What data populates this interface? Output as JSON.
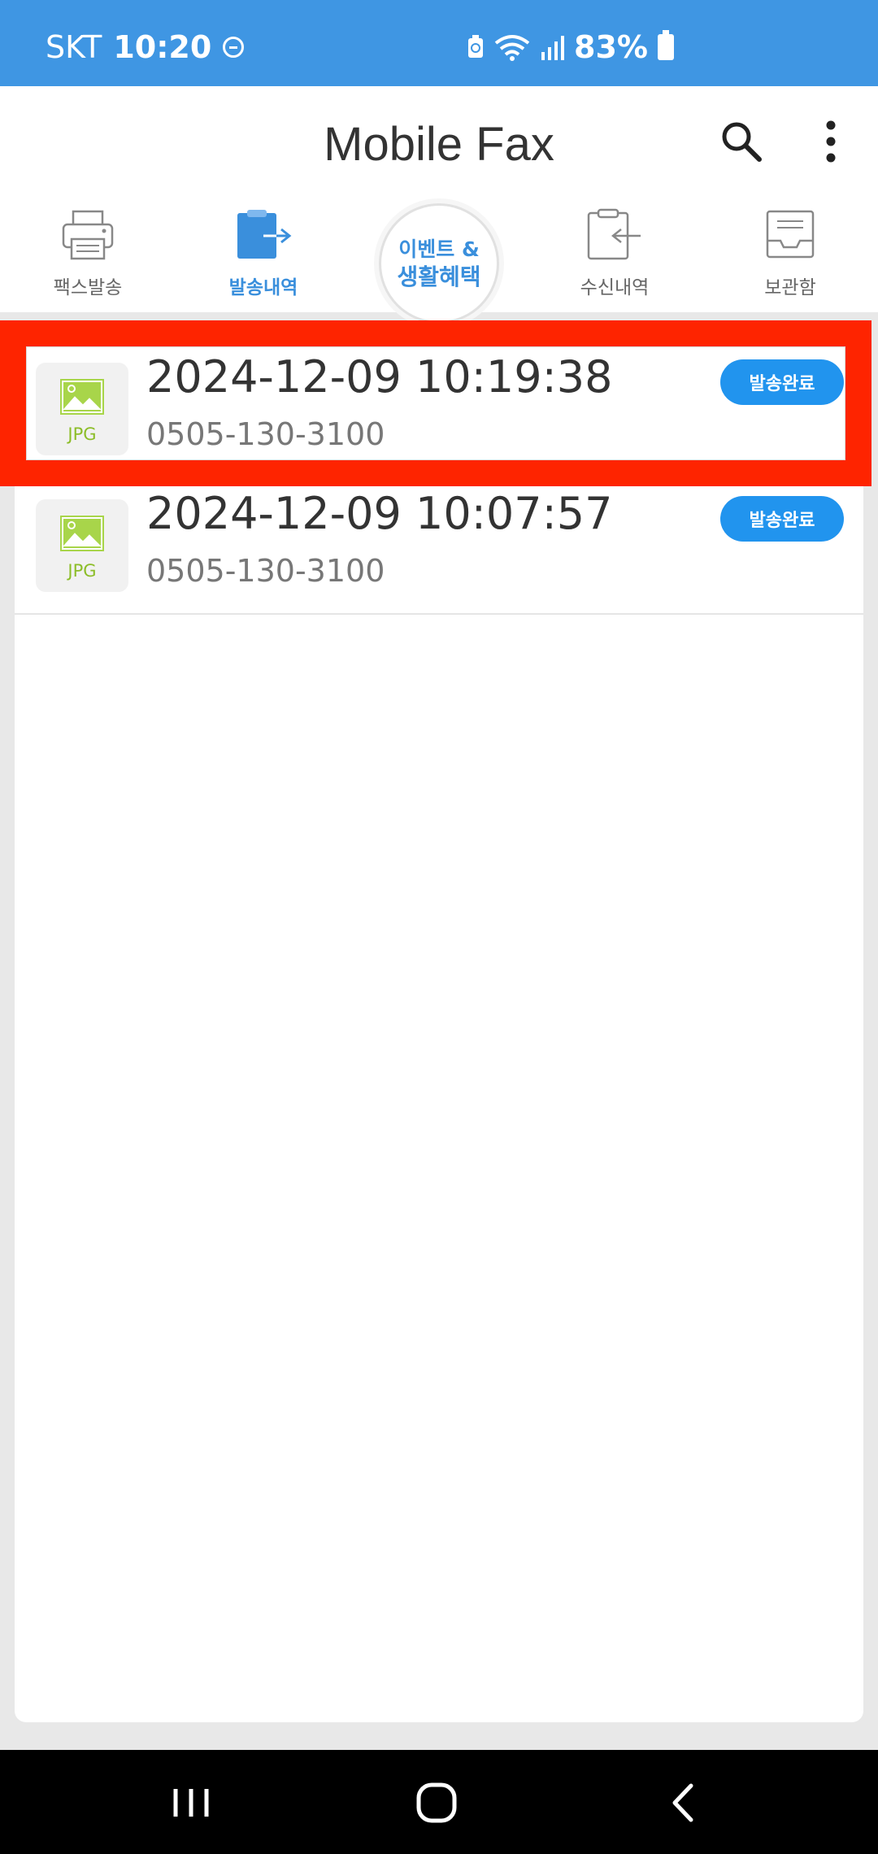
{
  "status_bar": {
    "carrier": "SKT",
    "time": "10:20",
    "battery": "83%",
    "icons": [
      "dnd-icon",
      "battery-saver-icon",
      "wifi-icon",
      "signal-icon",
      "battery-icon"
    ]
  },
  "app_bar": {
    "title": "Mobile Fax",
    "icons": [
      "search-icon",
      "more-vert-icon"
    ]
  },
  "tabs": [
    {
      "label": "팩스발송",
      "icon": "printer-icon",
      "active": false
    },
    {
      "label": "발송내역",
      "icon": "sent-clipboard-icon",
      "active": true
    },
    {
      "label": "수신내역",
      "icon": "received-clipboard-icon",
      "active": false
    },
    {
      "label": "보관함",
      "icon": "inbox-tray-icon",
      "active": false
    }
  ],
  "event_button": {
    "line1": "이벤트 &",
    "line2": "생활혜택"
  },
  "fax_list": [
    {
      "file_type": "JPG",
      "datetime": "2024-12-09 10:19:38",
      "number": "0505-130-3100",
      "status": "발송완료",
      "highlighted": true
    },
    {
      "file_type": "JPG",
      "datetime": "2024-12-09 10:07:57",
      "number": "0505-130-3100",
      "status": "발송완료",
      "highlighted": false
    }
  ],
  "colors": {
    "status_bar": "#3f96e3",
    "accent": "#3a8fdc",
    "badge": "#2194ee",
    "highlight": "#fe2400",
    "thumb_green": "#8cbd28"
  }
}
